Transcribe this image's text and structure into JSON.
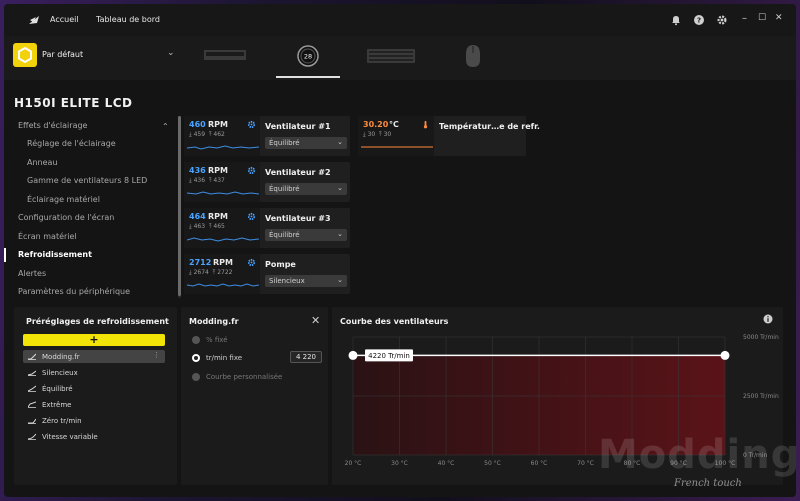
{
  "topbar": {
    "nav": [
      "Accueil",
      "Tableau de bord"
    ],
    "icons": [
      "bell-icon",
      "help-icon",
      "gear-icon"
    ],
    "window_controls": [
      "–",
      "☐",
      "✕"
    ]
  },
  "profile": {
    "name": "Par défaut"
  },
  "devices": [
    {
      "name": "memory-device-icon",
      "active": false
    },
    {
      "name": "lcd-cooler-device-icon",
      "active": true,
      "label": "28"
    },
    {
      "name": "keyboard-device-icon",
      "active": false
    },
    {
      "name": "mouse-device-icon",
      "active": false
    }
  ],
  "device_title": "H150I ELITE LCD",
  "sidebar": {
    "items": [
      {
        "label": "Effets d'éclairage",
        "sub": false
      },
      {
        "label": "Réglage de l'éclairage",
        "sub": true
      },
      {
        "label": "Anneau",
        "sub": true
      },
      {
        "label": "Gamme de ventilateurs 8 LED",
        "sub": true
      },
      {
        "label": "Éclairage matériel",
        "sub": true
      },
      {
        "label": "Configuration de l'écran",
        "sub": false
      },
      {
        "label": "Écran matériel",
        "sub": false
      },
      {
        "label": "Refroidissement",
        "sub": false,
        "active": true
      },
      {
        "label": "Alertes",
        "sub": false
      },
      {
        "label": "Paramètres du périphérique",
        "sub": false
      }
    ]
  },
  "sensors": [
    {
      "value": "460",
      "unit": "RPM",
      "min": "459",
      "max": "462",
      "name": "Ventilateur #1",
      "mode": "Équilibré"
    },
    {
      "value": "436",
      "unit": "RPM",
      "min": "436",
      "max": "437",
      "name": "Ventilateur #2",
      "mode": "Équilibré"
    },
    {
      "value": "464",
      "unit": "RPM",
      "min": "463",
      "max": "465",
      "name": "Ventilateur #3",
      "mode": "Équilibré"
    },
    {
      "value": "2712",
      "unit": "RPM",
      "min": "2674",
      "max": "2722",
      "name": "Pompe",
      "mode": "Silencieux"
    }
  ],
  "temperature": {
    "value": "30.20",
    "unit": "°C",
    "min": "30",
    "max": "30",
    "name": "Températur…e de refr."
  },
  "presets_panel": {
    "title": "Préréglages de refroidissement",
    "add_label": "+",
    "presets": [
      "Modding.fr",
      "Silencieux",
      "Équilibré",
      "Extrême",
      "Zéro tr/min",
      "Vitesse variable"
    ],
    "selected_index": 0
  },
  "mode_panel": {
    "title": "Modding.fr",
    "options": [
      "% fixé",
      "tr/min fixe",
      "Courbe personnalisée"
    ],
    "selected_index": 1,
    "rpm_value": "4 220"
  },
  "curve_panel": {
    "title": "Courbe des ventilateurs",
    "line_label": "4220 Tr/min"
  },
  "chart_data": {
    "type": "line",
    "title": "Courbe des ventilateurs",
    "x_ticks": [
      "20 °C",
      "30 °C",
      "40 °C",
      "50 °C",
      "60 °C",
      "70 °C",
      "80 °C",
      "90 °C",
      "100 °C"
    ],
    "y_ticks": [
      "5000 Tr/min",
      "2500 Tr/min",
      "0 Tr/min"
    ],
    "xlim": [
      20,
      100
    ],
    "ylim": [
      0,
      5000
    ],
    "series": [
      {
        "x": [
          20,
          100
        ],
        "y": [
          4220,
          4220
        ]
      }
    ]
  },
  "watermark": {
    "main": "Modding.fr",
    "sub": "French touch"
  }
}
